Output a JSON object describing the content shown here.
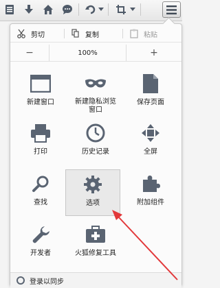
{
  "toolbar": {
    "icons": [
      "bookmark-list-icon",
      "download-icon",
      "home-icon",
      "chat-icon",
      "undo-icon",
      "dropdown-arrow-icon",
      "crop-icon",
      "dropdown-arrow-icon",
      "menu-icon"
    ]
  },
  "edit": {
    "cut": "剪切",
    "copy": "复制",
    "paste": "粘贴"
  },
  "zoom": {
    "minus": "−",
    "value": "100%",
    "plus": "+"
  },
  "tiles": {
    "new_window": "新建窗口",
    "private_window_line1": "新建隐私浏览",
    "private_window_line2": "窗口",
    "save_page": "保存页面",
    "print": "打印",
    "history": "历史记录",
    "fullscreen": "全屏",
    "find": "查找",
    "options": "选项",
    "addons": "附加组件",
    "developer": "开发者",
    "repair": "火狐修复工具"
  },
  "footer": {
    "signin": "登录以同步"
  },
  "colors": {
    "accent": "#e2383a",
    "icon": "#5a6472"
  }
}
